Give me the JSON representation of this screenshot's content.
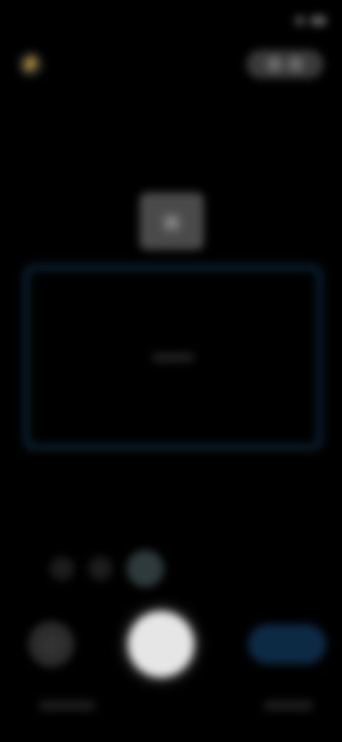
{
  "status_bar": {
    "time": "",
    "icons": [
      "signal-icon",
      "battery-icon"
    ]
  },
  "top_controls": {
    "flash_icon": "flash-icon",
    "settings_icons": [
      "settings-icon",
      "more-icon"
    ]
  },
  "mode_badge": {
    "icon": "document-icon"
  },
  "scan_frame": {
    "hint": ""
  },
  "zoom": {
    "options": [
      "",
      "",
      ""
    ],
    "active_index": 2
  },
  "bottom_controls": {
    "gallery_icon": "gallery-icon",
    "shutter_icon": "shutter-button",
    "send_label": ""
  },
  "bottom_labels": {
    "left": "",
    "right": ""
  },
  "colors": {
    "background": "#000000",
    "frame_border": "#0a1e2e",
    "shutter": "#e6e6e6",
    "send_button": "#0d2a44"
  }
}
